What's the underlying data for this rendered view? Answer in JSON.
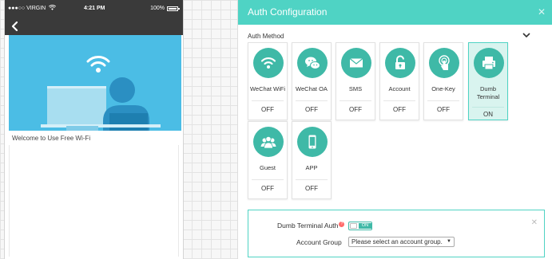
{
  "phone": {
    "carrier": "●●●○○ VIRGIN",
    "time": "4:21 PM",
    "battery": "100%",
    "welcome_text": "Welcome to Use Free Wi-Fi"
  },
  "panel": {
    "title": "Auth Configuration",
    "auth_method_label": "Auth Method",
    "accent_color": "#4fd3c4",
    "icon_color": "#3fb9a7",
    "methods": [
      {
        "label": "WeChat WiFi",
        "status": "OFF",
        "icon": "wifi-icon"
      },
      {
        "label": "WeChat OA",
        "status": "OFF",
        "icon": "chat-bubbles-icon"
      },
      {
        "label": "SMS",
        "status": "OFF",
        "icon": "envelope-icon"
      },
      {
        "label": "Account",
        "status": "OFF",
        "icon": "padlock-icon"
      },
      {
        "label": "One-Key",
        "status": "OFF",
        "icon": "touch-icon"
      },
      {
        "label": "Dumb Terminal",
        "status": "ON",
        "icon": "printer-icon"
      },
      {
        "label": "Guest",
        "status": "OFF",
        "icon": "users-icon"
      },
      {
        "label": "APP",
        "status": "OFF",
        "icon": "smartphone-icon"
      }
    ]
  },
  "settings": {
    "dumb_terminal_auth_label": "Dumb Terminal Auth",
    "help_mark": "?",
    "toggle_text": "ON",
    "account_group_label": "Account Group",
    "account_group_value": "Please select an account group."
  }
}
